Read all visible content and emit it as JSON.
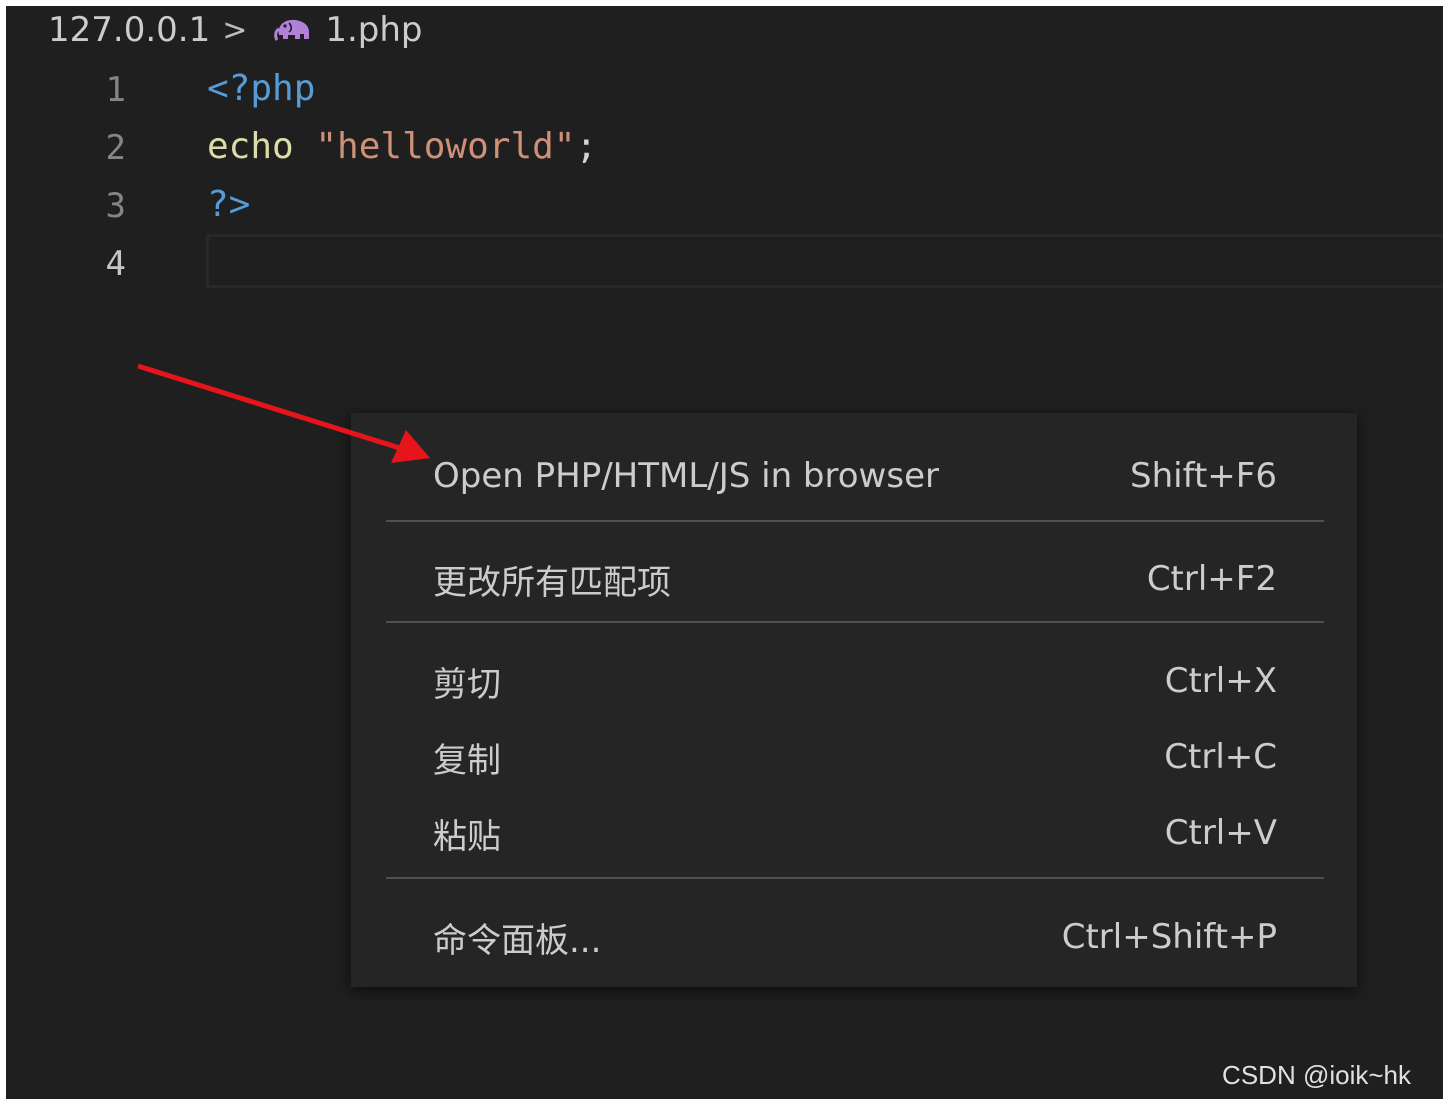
{
  "breadcrumb": {
    "host": "127.0.0.1",
    "separator": ">",
    "file_icon": "php-elephant-icon",
    "file": "1.php"
  },
  "editor": {
    "lines": [
      {
        "number": "1",
        "tokens": [
          {
            "t": "<?php",
            "c": "tag"
          }
        ]
      },
      {
        "number": "2",
        "tokens": [
          {
            "t": "echo ",
            "c": "kw"
          },
          {
            "t": "\"helloworld\"",
            "c": "str"
          },
          {
            "t": ";",
            "c": "punc"
          }
        ]
      },
      {
        "number": "3",
        "tokens": [
          {
            "t": "?>",
            "c": "tag"
          }
        ]
      },
      {
        "number": "4",
        "tokens": []
      }
    ],
    "active_line": "4"
  },
  "context_menu": {
    "items": [
      {
        "label": "Open PHP/HTML/JS in browser",
        "shortcut": "Shift+F6"
      },
      {
        "label": "更改所有匹配项",
        "shortcut": "Ctrl+F2"
      },
      {
        "label": "剪切",
        "shortcut": "Ctrl+X"
      },
      {
        "label": "复制",
        "shortcut": "Ctrl+C"
      },
      {
        "label": "粘贴",
        "shortcut": "Ctrl+V"
      },
      {
        "label": "命令面板...",
        "shortcut": "Ctrl+Shift+P"
      }
    ]
  },
  "annotation": {
    "arrow_color": "#e8141c"
  },
  "watermark": "CSDN @ioik~hk",
  "colors": {
    "editor_bg": "#1f1f1f",
    "menu_bg": "#252526",
    "tag": "#569cd6",
    "keyword": "#dcdcaa",
    "string": "#ce9178",
    "icon_purple": "#b180d7"
  }
}
